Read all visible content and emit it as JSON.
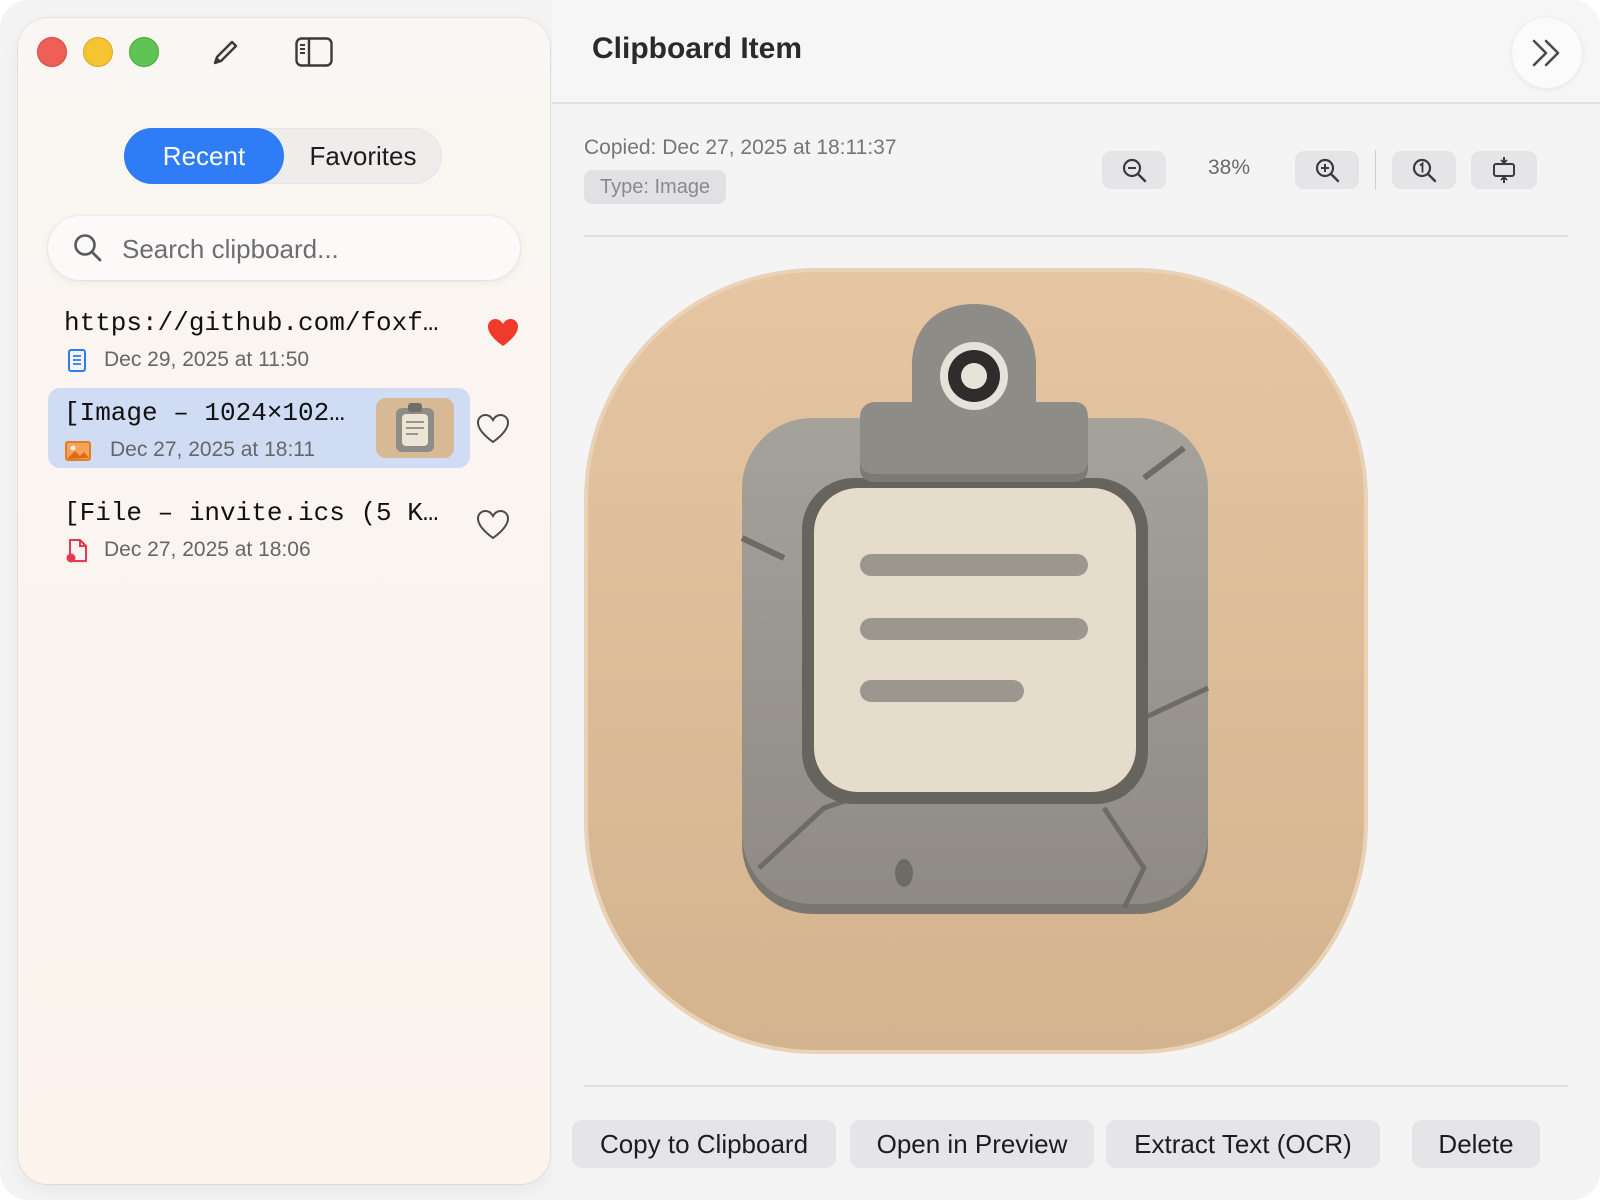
{
  "window": {
    "title": "Clipboard Item",
    "colors": {
      "accent": "#2e7cf6",
      "selection": "#cfdcf4",
      "favorite": "#f03a2c"
    }
  },
  "toolbar": {
    "pencil_icon": "pencil-icon",
    "sidebar_toggle_icon": "sidebar-toggle-icon"
  },
  "sidebar": {
    "segments": [
      {
        "label": "Recent",
        "active": true
      },
      {
        "label": "Favorites",
        "active": false
      }
    ],
    "search": {
      "placeholder": "Search clipboard...",
      "value": ""
    },
    "items": [
      {
        "title": "https://github.com/foxf…",
        "date": "Dec 29, 2025 at 11:50",
        "type_icon": "text-document-icon",
        "favorite": true
      },
      {
        "title": "[Image – 1024×102…",
        "date": "Dec 27, 2025 at 18:11",
        "type_icon": "image-icon",
        "favorite": false,
        "selected": true,
        "has_thumbnail": true
      },
      {
        "title": "[File – invite.ics (5 K…",
        "date": "Dec 27, 2025 at 18:06",
        "type_icon": "file-icon",
        "favorite": false
      }
    ]
  },
  "detail": {
    "copied": "Copied: Dec 27, 2025 at 18:11:37",
    "type": "Type: Image",
    "zoom": "38%",
    "actions": {
      "copy": "Copy to Clipboard",
      "preview": "Open in Preview",
      "ocr": "Extract Text (OCR)",
      "delete": "Delete"
    }
  }
}
